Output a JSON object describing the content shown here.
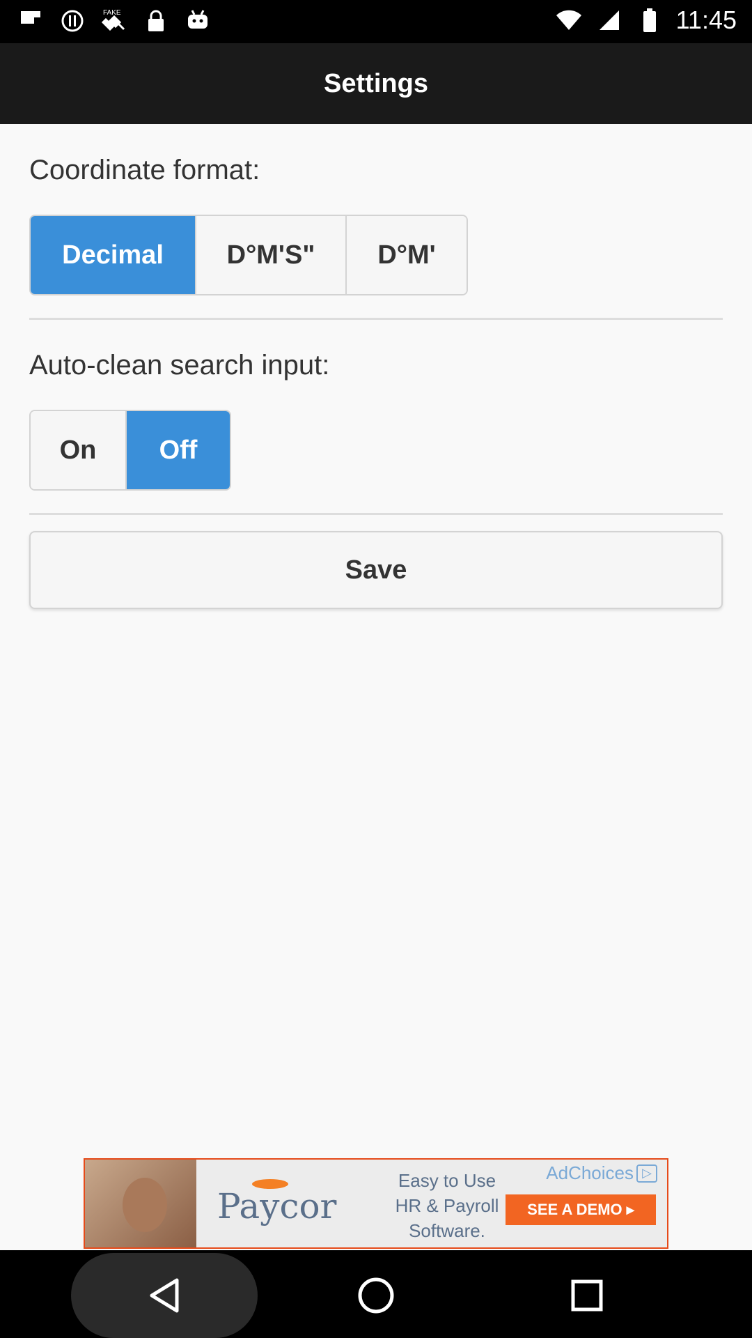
{
  "status_bar": {
    "time": "11:45",
    "icons": [
      "flipboard-icon",
      "sync-icon",
      "fake-gps-icon",
      "lock-icon",
      "android-icon"
    ],
    "right_icons": [
      "wifi-icon",
      "signal-icon",
      "battery-icon"
    ]
  },
  "header": {
    "title": "Settings"
  },
  "coordinate_format": {
    "label": "Coordinate format:",
    "options": [
      "Decimal",
      "D°M'S\"",
      "D°M'"
    ],
    "selected": "Decimal"
  },
  "auto_clean": {
    "label": "Auto-clean search input:",
    "options": [
      "On",
      "Off"
    ],
    "selected": "Off"
  },
  "save_button": {
    "label": "Save"
  },
  "ad": {
    "brand": "Paycor",
    "copy_line1": "Easy to Use",
    "copy_line2": "HR & Payroll",
    "copy_line3": "Software.",
    "adchoices": "AdChoices",
    "cta": "SEE A DEMO ▸",
    "accent_color": "#f26522"
  },
  "nav_bar": {
    "buttons": [
      "back-icon",
      "home-icon",
      "recent-apps-icon"
    ]
  },
  "colors": {
    "accent": "#3a8fd9",
    "header_bg": "#1a1a1a"
  }
}
